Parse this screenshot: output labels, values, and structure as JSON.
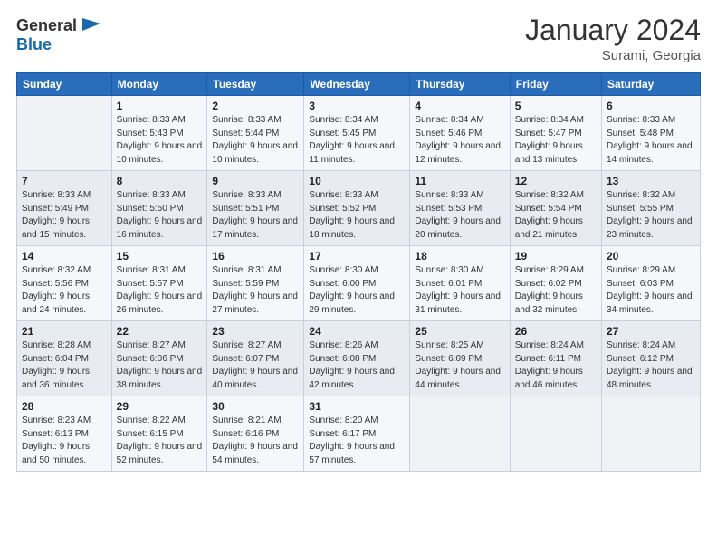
{
  "header": {
    "logo_general": "General",
    "logo_blue": "Blue",
    "month_year": "January 2024",
    "location": "Surami, Georgia"
  },
  "days_of_week": [
    "Sunday",
    "Monday",
    "Tuesday",
    "Wednesday",
    "Thursday",
    "Friday",
    "Saturday"
  ],
  "weeks": [
    [
      {
        "day": "",
        "sunrise": "",
        "sunset": "",
        "daylight": ""
      },
      {
        "day": "1",
        "sunrise": "Sunrise: 8:33 AM",
        "sunset": "Sunset: 5:43 PM",
        "daylight": "Daylight: 9 hours and 10 minutes."
      },
      {
        "day": "2",
        "sunrise": "Sunrise: 8:33 AM",
        "sunset": "Sunset: 5:44 PM",
        "daylight": "Daylight: 9 hours and 10 minutes."
      },
      {
        "day": "3",
        "sunrise": "Sunrise: 8:34 AM",
        "sunset": "Sunset: 5:45 PM",
        "daylight": "Daylight: 9 hours and 11 minutes."
      },
      {
        "day": "4",
        "sunrise": "Sunrise: 8:34 AM",
        "sunset": "Sunset: 5:46 PM",
        "daylight": "Daylight: 9 hours and 12 minutes."
      },
      {
        "day": "5",
        "sunrise": "Sunrise: 8:34 AM",
        "sunset": "Sunset: 5:47 PM",
        "daylight": "Daylight: 9 hours and 13 minutes."
      },
      {
        "day": "6",
        "sunrise": "Sunrise: 8:33 AM",
        "sunset": "Sunset: 5:48 PM",
        "daylight": "Daylight: 9 hours and 14 minutes."
      }
    ],
    [
      {
        "day": "7",
        "sunrise": "Sunrise: 8:33 AM",
        "sunset": "Sunset: 5:49 PM",
        "daylight": "Daylight: 9 hours and 15 minutes."
      },
      {
        "day": "8",
        "sunrise": "Sunrise: 8:33 AM",
        "sunset": "Sunset: 5:50 PM",
        "daylight": "Daylight: 9 hours and 16 minutes."
      },
      {
        "day": "9",
        "sunrise": "Sunrise: 8:33 AM",
        "sunset": "Sunset: 5:51 PM",
        "daylight": "Daylight: 9 hours and 17 minutes."
      },
      {
        "day": "10",
        "sunrise": "Sunrise: 8:33 AM",
        "sunset": "Sunset: 5:52 PM",
        "daylight": "Daylight: 9 hours and 18 minutes."
      },
      {
        "day": "11",
        "sunrise": "Sunrise: 8:33 AM",
        "sunset": "Sunset: 5:53 PM",
        "daylight": "Daylight: 9 hours and 20 minutes."
      },
      {
        "day": "12",
        "sunrise": "Sunrise: 8:32 AM",
        "sunset": "Sunset: 5:54 PM",
        "daylight": "Daylight: 9 hours and 21 minutes."
      },
      {
        "day": "13",
        "sunrise": "Sunrise: 8:32 AM",
        "sunset": "Sunset: 5:55 PM",
        "daylight": "Daylight: 9 hours and 23 minutes."
      }
    ],
    [
      {
        "day": "14",
        "sunrise": "Sunrise: 8:32 AM",
        "sunset": "Sunset: 5:56 PM",
        "daylight": "Daylight: 9 hours and 24 minutes."
      },
      {
        "day": "15",
        "sunrise": "Sunrise: 8:31 AM",
        "sunset": "Sunset: 5:57 PM",
        "daylight": "Daylight: 9 hours and 26 minutes."
      },
      {
        "day": "16",
        "sunrise": "Sunrise: 8:31 AM",
        "sunset": "Sunset: 5:59 PM",
        "daylight": "Daylight: 9 hours and 27 minutes."
      },
      {
        "day": "17",
        "sunrise": "Sunrise: 8:30 AM",
        "sunset": "Sunset: 6:00 PM",
        "daylight": "Daylight: 9 hours and 29 minutes."
      },
      {
        "day": "18",
        "sunrise": "Sunrise: 8:30 AM",
        "sunset": "Sunset: 6:01 PM",
        "daylight": "Daylight: 9 hours and 31 minutes."
      },
      {
        "day": "19",
        "sunrise": "Sunrise: 8:29 AM",
        "sunset": "Sunset: 6:02 PM",
        "daylight": "Daylight: 9 hours and 32 minutes."
      },
      {
        "day": "20",
        "sunrise": "Sunrise: 8:29 AM",
        "sunset": "Sunset: 6:03 PM",
        "daylight": "Daylight: 9 hours and 34 minutes."
      }
    ],
    [
      {
        "day": "21",
        "sunrise": "Sunrise: 8:28 AM",
        "sunset": "Sunset: 6:04 PM",
        "daylight": "Daylight: 9 hours and 36 minutes."
      },
      {
        "day": "22",
        "sunrise": "Sunrise: 8:27 AM",
        "sunset": "Sunset: 6:06 PM",
        "daylight": "Daylight: 9 hours and 38 minutes."
      },
      {
        "day": "23",
        "sunrise": "Sunrise: 8:27 AM",
        "sunset": "Sunset: 6:07 PM",
        "daylight": "Daylight: 9 hours and 40 minutes."
      },
      {
        "day": "24",
        "sunrise": "Sunrise: 8:26 AM",
        "sunset": "Sunset: 6:08 PM",
        "daylight": "Daylight: 9 hours and 42 minutes."
      },
      {
        "day": "25",
        "sunrise": "Sunrise: 8:25 AM",
        "sunset": "Sunset: 6:09 PM",
        "daylight": "Daylight: 9 hours and 44 minutes."
      },
      {
        "day": "26",
        "sunrise": "Sunrise: 8:24 AM",
        "sunset": "Sunset: 6:11 PM",
        "daylight": "Daylight: 9 hours and 46 minutes."
      },
      {
        "day": "27",
        "sunrise": "Sunrise: 8:24 AM",
        "sunset": "Sunset: 6:12 PM",
        "daylight": "Daylight: 9 hours and 48 minutes."
      }
    ],
    [
      {
        "day": "28",
        "sunrise": "Sunrise: 8:23 AM",
        "sunset": "Sunset: 6:13 PM",
        "daylight": "Daylight: 9 hours and 50 minutes."
      },
      {
        "day": "29",
        "sunrise": "Sunrise: 8:22 AM",
        "sunset": "Sunset: 6:15 PM",
        "daylight": "Daylight: 9 hours and 52 minutes."
      },
      {
        "day": "30",
        "sunrise": "Sunrise: 8:21 AM",
        "sunset": "Sunset: 6:16 PM",
        "daylight": "Daylight: 9 hours and 54 minutes."
      },
      {
        "day": "31",
        "sunrise": "Sunrise: 8:20 AM",
        "sunset": "Sunset: 6:17 PM",
        "daylight": "Daylight: 9 hours and 57 minutes."
      },
      {
        "day": "",
        "sunrise": "",
        "sunset": "",
        "daylight": ""
      },
      {
        "day": "",
        "sunrise": "",
        "sunset": "",
        "daylight": ""
      },
      {
        "day": "",
        "sunrise": "",
        "sunset": "",
        "daylight": ""
      }
    ]
  ]
}
